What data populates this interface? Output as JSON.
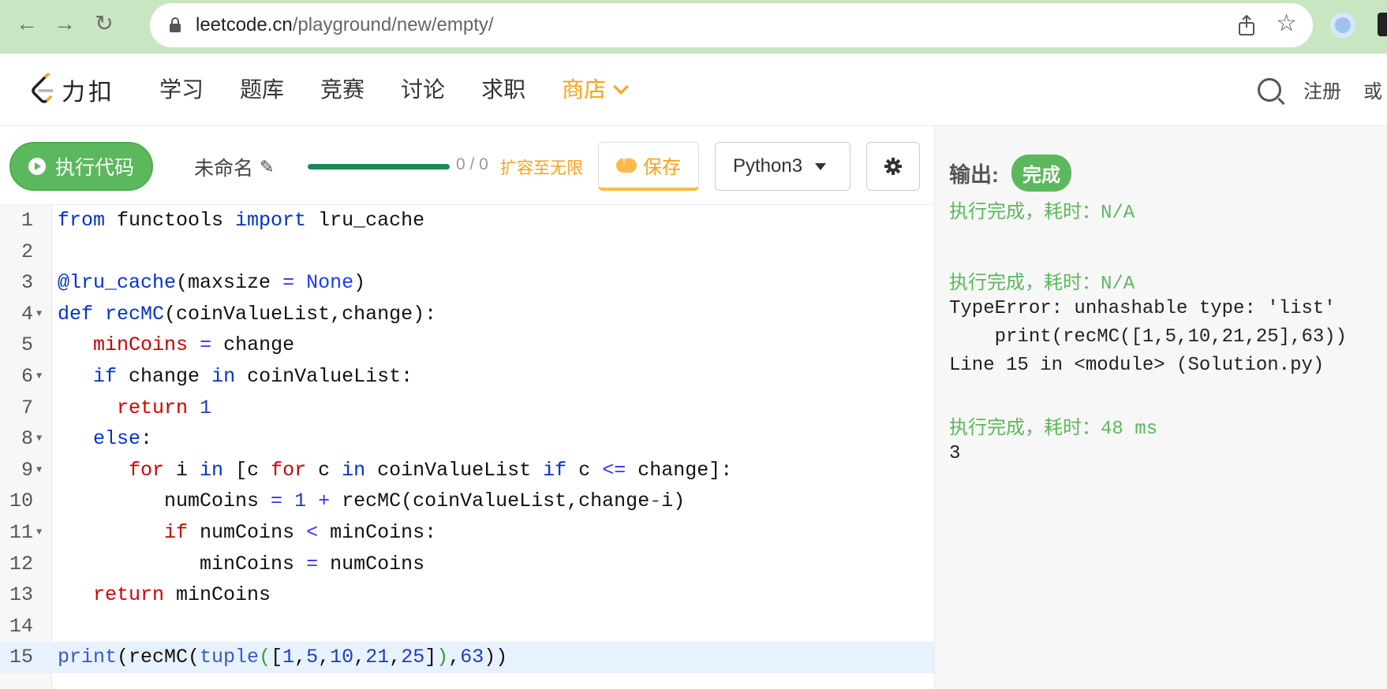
{
  "browser": {
    "url_host": "leetcode.cn",
    "url_path": "/playground/new/empty/"
  },
  "header": {
    "logo_text": "力扣",
    "nav": [
      "学习",
      "题库",
      "竞赛",
      "讨论",
      "求职",
      "商店"
    ],
    "signup": "注册",
    "or": "或"
  },
  "toolbar": {
    "run_label": "执行代码",
    "filename": "未命名",
    "quota": "0 / 0",
    "expand": "扩容至无限",
    "save_label": "保存",
    "language": "Python3"
  },
  "editor": {
    "line_numbers": [
      "1",
      "2",
      "3",
      "4",
      "5",
      "6",
      "7",
      "8",
      "9",
      "10",
      "11",
      "12",
      "13",
      "14",
      "15"
    ]
  },
  "output": {
    "label": "输出:",
    "status": "完成",
    "runs": [
      {
        "status": "执行完成，耗时：N/A",
        "text": ""
      },
      {
        "status": "执行完成，耗时：N/A",
        "text": "TypeError: unhashable type: 'list'\n    print(recMC([1,5,10,21,25],63))\nLine 15 in <module> (Solution.py)"
      },
      {
        "status": "执行完成，耗时：48 ms",
        "text": "3"
      }
    ]
  },
  "colors": {
    "accent_green": "#5cb85c",
    "accent_orange": "#ffa116",
    "chrome_bg": "#c9e6c3"
  },
  "icons": [
    "back-icon",
    "forward-icon",
    "reload-icon",
    "lock-icon",
    "share-icon",
    "star-icon",
    "search-icon",
    "play-icon",
    "pencil-icon",
    "cloud-upload-icon",
    "caret-down-icon",
    "gear-icon",
    "chevron-down-icon"
  ]
}
